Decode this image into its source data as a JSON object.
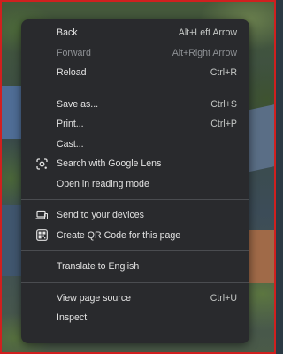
{
  "menu": {
    "items": [
      {
        "label": "Back",
        "shortcut": "Alt+Left Arrow"
      },
      {
        "label": "Forward",
        "shortcut": "Alt+Right Arrow"
      },
      {
        "label": "Reload",
        "shortcut": "Ctrl+R"
      },
      {
        "label": "Save as...",
        "shortcut": "Ctrl+S"
      },
      {
        "label": "Print...",
        "shortcut": "Ctrl+P"
      },
      {
        "label": "Cast...",
        "shortcut": ""
      },
      {
        "label": "Search with Google Lens",
        "shortcut": "",
        "icon": "google-lens-icon"
      },
      {
        "label": "Open in reading mode",
        "shortcut": ""
      },
      {
        "label": "Send to your devices",
        "shortcut": "",
        "icon": "laptop-send-icon"
      },
      {
        "label": "Create QR Code for this page",
        "shortcut": "",
        "icon": "qr-code-icon"
      },
      {
        "label": "Translate to English",
        "shortcut": ""
      },
      {
        "label": "View page source",
        "shortcut": "Ctrl+U"
      },
      {
        "label": "Inspect",
        "shortcut": ""
      }
    ]
  },
  "colors": {
    "menu_bg": "#292a2d",
    "text": "#e3e3e3",
    "disabled_text": "#8e9195",
    "separator": "#4a4c50",
    "frame_border": "#d0201f"
  }
}
